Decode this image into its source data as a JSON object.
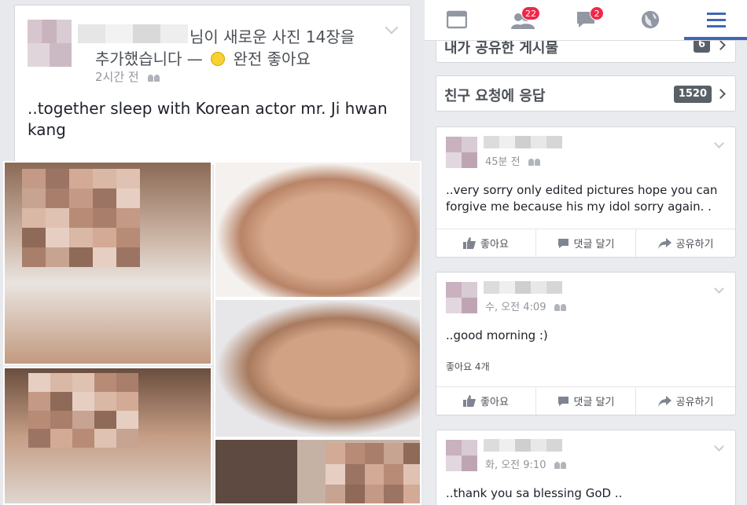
{
  "left_post": {
    "story_line1": "님이 새로운 사진 14장을",
    "story_line2_prefix": "추가했습니다 —",
    "feeling": "완전 좋아요",
    "time": "2시간 전",
    "text": "..together sleep with Korean actor mr. Ji hwan kang"
  },
  "nav": {
    "friend_requests_badge": "22",
    "messages_badge": "2",
    "icons": [
      "news-feed-icon",
      "friends-icon",
      "messages-icon",
      "globe-icon",
      "menu-icon"
    ],
    "active_color": "#4267b2"
  },
  "rows": {
    "saved_label": "내가 공유한 게시물",
    "saved_count": "6",
    "friend_requests_label": "친구 요청에 응답",
    "friend_requests_count": "1520"
  },
  "posts": [
    {
      "time": "45분 전",
      "text": "..very sorry only edited pictures hope you can forgive me  because his my idol sorry again. .",
      "like": "좋아요",
      "comment": "댓글 달기",
      "share": "공유하기"
    },
    {
      "time": "수, 오전 4:09",
      "text": "..good morning :)",
      "likes_count": "좋아요 4개",
      "like": "좋아요",
      "comment": "댓글 달기",
      "share": "공유하기"
    },
    {
      "time": "화, 오전 9:10",
      "text": "..thank you sa blessing GoD .."
    }
  ]
}
